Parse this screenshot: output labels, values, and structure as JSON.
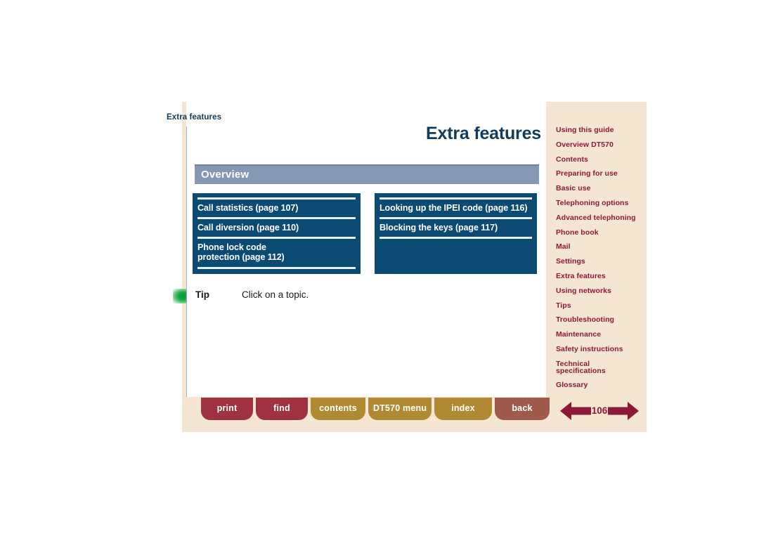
{
  "document": {
    "running_head": "Extra features",
    "page_title": "Extra features",
    "page_number": "106"
  },
  "section": {
    "heading": "Overview"
  },
  "topics": {
    "left_column": [
      {
        "label": "Call statistics (page 107)"
      },
      {
        "label": "Call diversion (page 110)"
      },
      {
        "label": "Phone lock code\nprotection (page 112)"
      }
    ],
    "right_column": [
      {
        "label": "Looking up the IPEI code (page 116)"
      },
      {
        "label": "Blocking the keys (page 117)"
      }
    ]
  },
  "tip": {
    "icon": "green-gradient-icon",
    "label": "Tip",
    "text": "Click on a topic."
  },
  "sidebar": {
    "items": [
      {
        "label": "Using this guide"
      },
      {
        "label": "Overview DT570"
      },
      {
        "label": "Contents"
      },
      {
        "label": "Preparing for use"
      },
      {
        "label": "Basic use"
      },
      {
        "label": "Telephoning options"
      },
      {
        "label": "Advanced telephoning"
      },
      {
        "label": "Phone book"
      },
      {
        "label": "Mail"
      },
      {
        "label": "Settings"
      },
      {
        "label": "Extra features"
      },
      {
        "label": "Using networks"
      },
      {
        "label": "Tips"
      },
      {
        "label": "Troubleshooting"
      },
      {
        "label": "Maintenance"
      },
      {
        "label": "Safety instructions"
      },
      {
        "label": "Technical\nspecifications"
      },
      {
        "label": "Glossary"
      }
    ]
  },
  "toolbar": {
    "print_label": "print",
    "find_label": "find",
    "contents_label": "contents",
    "menu_label": "DT570 menu",
    "index_label": "index",
    "back_label": "back"
  },
  "pager": {
    "prev_icon": "arrow-left-icon",
    "next_icon": "arrow-right-icon",
    "page_number": "106"
  },
  "colors": {
    "beige_panel": "#f4e6d3",
    "dark_blue": "#0b4a73",
    "title_blue": "#123a5a",
    "section_bar": "#8697b4",
    "sidebar_red": "#8e1838",
    "btn_red": "#9e3240",
    "btn_gold": "#b08a33",
    "btn_brown": "#a05a4a",
    "arrow_red": "#8e1838",
    "tip_green": "#00a038"
  }
}
